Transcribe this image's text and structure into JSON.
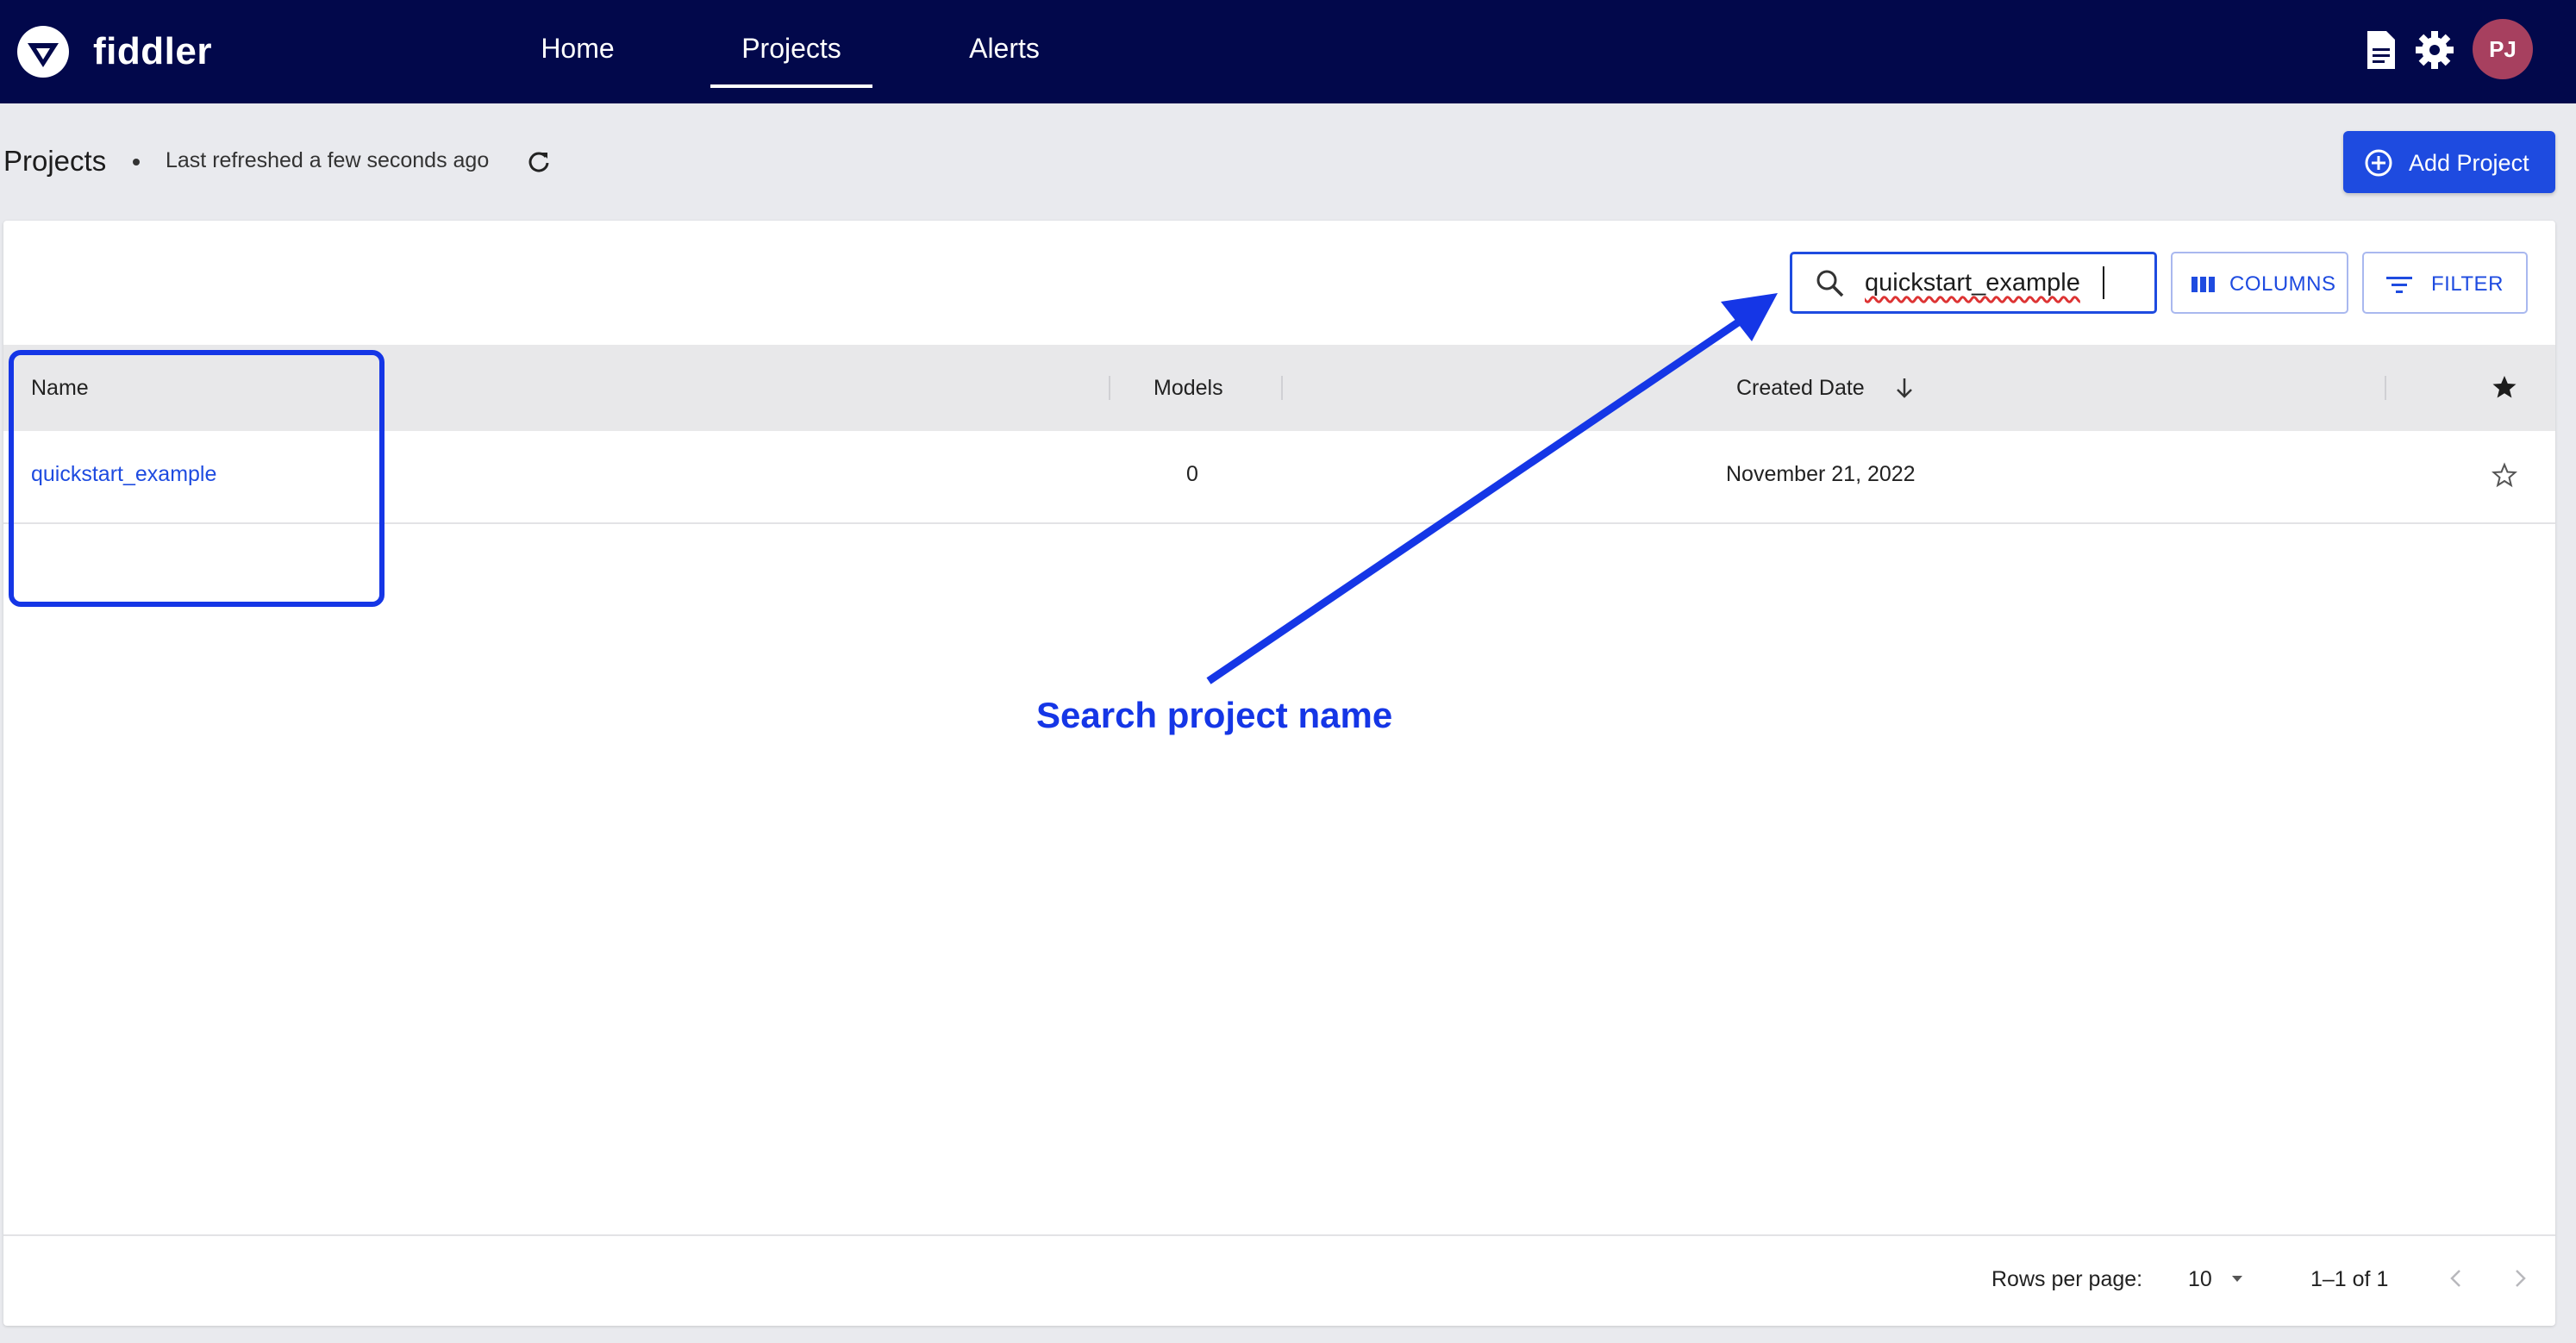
{
  "app": {
    "brand": "fiddler",
    "nav": [
      {
        "label": "Home",
        "active": false
      },
      {
        "label": "Projects",
        "active": true
      },
      {
        "label": "Alerts",
        "active": false
      }
    ],
    "user_initials": "PJ",
    "icons": [
      "document-icon",
      "gear-icon"
    ]
  },
  "header": {
    "title": "Projects",
    "refreshed": "Last refreshed a few seconds ago",
    "add_button": "Add Project"
  },
  "toolbar": {
    "search_value": "quickstart_example",
    "columns_label": "COLUMNS",
    "filter_label": "FILTER"
  },
  "table": {
    "columns": [
      "Name",
      "Models",
      "Created Date"
    ],
    "sort": "Created Date descending",
    "rows": [
      {
        "name": "quickstart_example",
        "models": "0",
        "created": "November 21, 2022",
        "starred": false
      }
    ]
  },
  "pagination": {
    "rows_label": "Rows per page:",
    "rows_value": "10",
    "range": "1–1 of 1"
  },
  "annotation": {
    "text": "Search project name"
  },
  "colors": {
    "topbar": "#02084b",
    "accent": "#1e4be0",
    "annotation": "#1536e6",
    "avatar": "#a7405f"
  }
}
